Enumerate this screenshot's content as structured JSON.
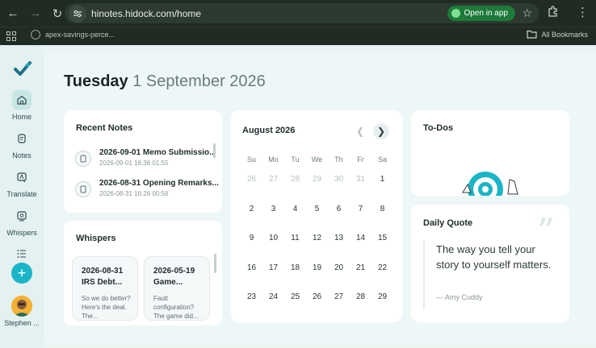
{
  "browser": {
    "url": "hinotes.hidock.com/home",
    "open_in_app_label": "Open in app",
    "bookmark_label": "apex-savings-perce...",
    "all_bookmarks_label": "All Bookmarks"
  },
  "sidebar": {
    "items": [
      {
        "label": "Home",
        "icon": "home-icon",
        "active": true
      },
      {
        "label": "Notes",
        "icon": "notes-icon"
      },
      {
        "label": "Translate",
        "icon": "translate-icon"
      },
      {
        "label": "Whispers",
        "icon": "whispers-icon"
      }
    ],
    "user_name": "Stephen ..."
  },
  "header": {
    "weekday": "Tuesday",
    "date": "1 September 2026"
  },
  "recent_notes": {
    "title": "Recent Notes",
    "items": [
      {
        "title": "2026-09-01 Memo Submissio...",
        "time": "2026-09-01 16:36 01:55"
      },
      {
        "title": "2026-08-31 Opening Remarks...",
        "time": "2026-08-31 16:26 00:56"
      }
    ]
  },
  "whispers": {
    "title": "Whispers",
    "items": [
      {
        "date": "2026-08-31",
        "title": "IRS Debt...",
        "body": "So we do better? Here's the deal. The..."
      },
      {
        "date": "2026-05-19",
        "title": "Game...",
        "body": "Fault configuration? The game did..."
      }
    ]
  },
  "calendar": {
    "month": "August 2026",
    "weekdays": [
      "Su",
      "Mo",
      "Tu",
      "We",
      "Th",
      "Fr",
      "Sa"
    ],
    "days": [
      {
        "d": "26",
        "muted": true
      },
      {
        "d": "27",
        "muted": true
      },
      {
        "d": "28",
        "muted": true
      },
      {
        "d": "29",
        "muted": true
      },
      {
        "d": "30",
        "muted": true
      },
      {
        "d": "31",
        "muted": true
      },
      {
        "d": "1"
      },
      {
        "d": "2"
      },
      {
        "d": "3"
      },
      {
        "d": "4"
      },
      {
        "d": "5"
      },
      {
        "d": "6"
      },
      {
        "d": "7"
      },
      {
        "d": "8"
      },
      {
        "d": "9"
      },
      {
        "d": "10"
      },
      {
        "d": "11"
      },
      {
        "d": "12"
      },
      {
        "d": "13"
      },
      {
        "d": "14"
      },
      {
        "d": "15"
      },
      {
        "d": "16"
      },
      {
        "d": "17"
      },
      {
        "d": "18"
      },
      {
        "d": "19"
      },
      {
        "d": "20"
      },
      {
        "d": "21"
      },
      {
        "d": "22"
      },
      {
        "d": "23"
      },
      {
        "d": "24"
      },
      {
        "d": "25"
      },
      {
        "d": "26"
      },
      {
        "d": "27"
      },
      {
        "d": "28"
      },
      {
        "d": "29"
      }
    ]
  },
  "todos": {
    "title": "To-Dos"
  },
  "daily_quote": {
    "title": "Daily Quote",
    "text": "The way you tell your story to yourself matters.",
    "author": "— Amy Cuddy"
  },
  "colors": {
    "accent": "#1ab5c6",
    "open_in_app": "#1e7a3a",
    "chrome": "#1f2b23"
  }
}
